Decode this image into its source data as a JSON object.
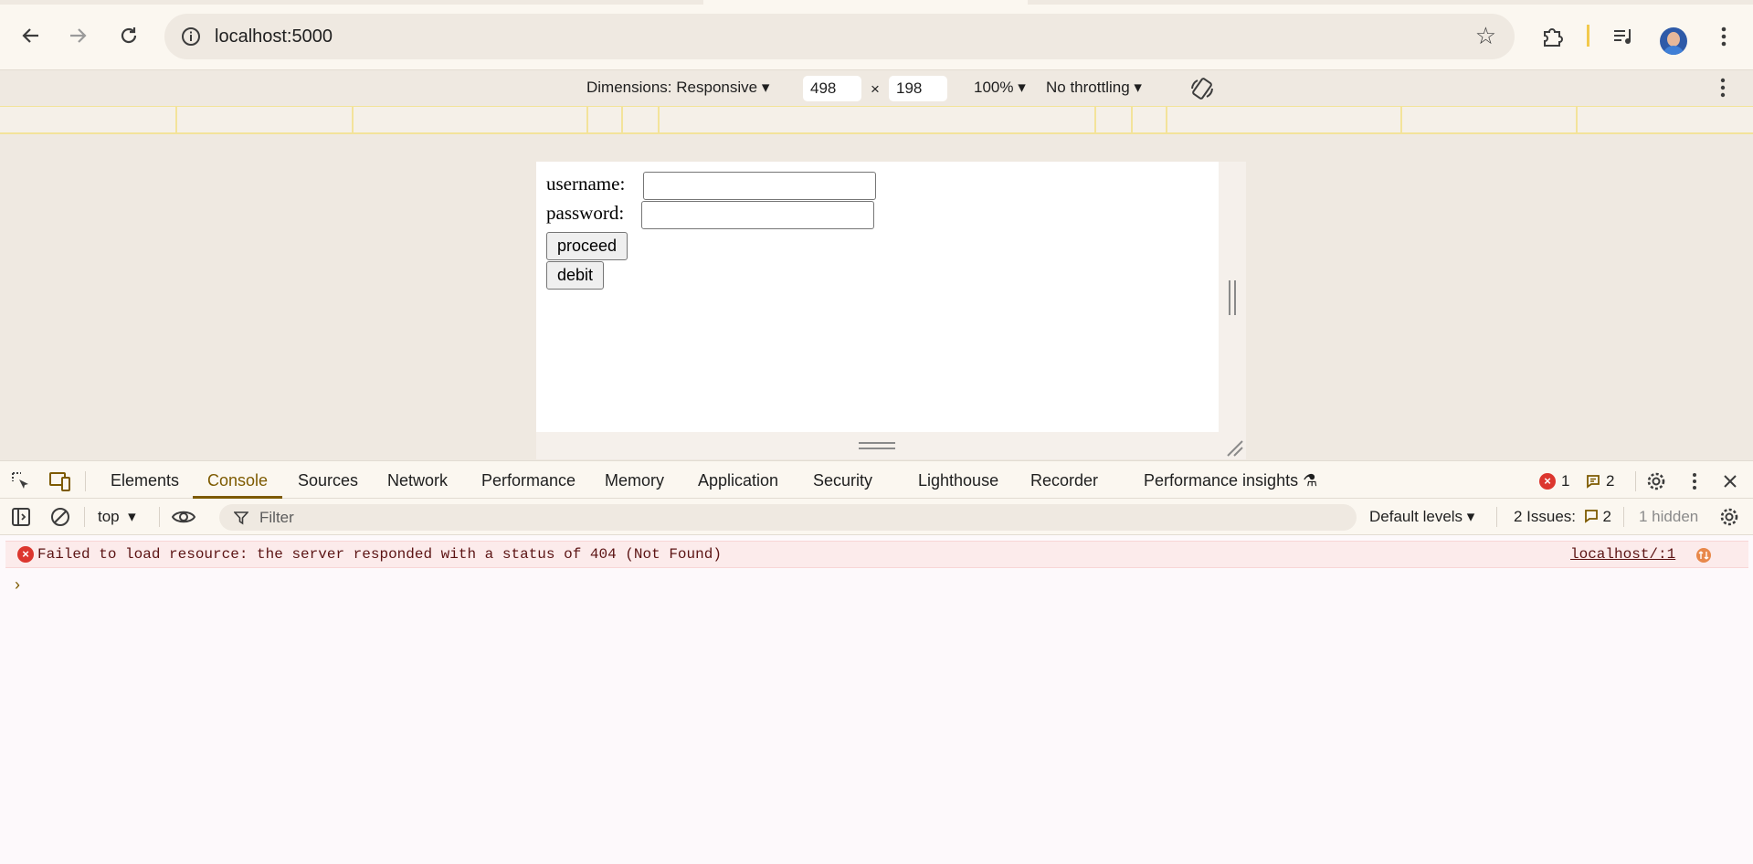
{
  "browser": {
    "url": "localhost:5000"
  },
  "device_toolbar": {
    "dimensions_label": "Dimensions: Responsive",
    "width": "498",
    "separator": "×",
    "height": "198",
    "zoom": "100%",
    "throttling": "No throttling"
  },
  "page": {
    "username_label": "username:",
    "password_label": "password:",
    "proceed_label": "proceed",
    "debit_label": "debit"
  },
  "devtools": {
    "tabs": [
      "Elements",
      "Console",
      "Sources",
      "Network",
      "Performance",
      "Memory",
      "Application",
      "Security",
      "Lighthouse",
      "Recorder",
      "Performance insights"
    ],
    "active_tab": "Console",
    "error_count": "1",
    "message_count": "2"
  },
  "console": {
    "context": "top",
    "filter_placeholder": "Filter",
    "levels": "Default levels",
    "issues_label": "2 Issues:",
    "issues_count": "2",
    "hidden": "1 hidden",
    "error_message": "Failed to load resource: the server responded with a status of 404 (Not Found)",
    "error_source": "localhost/:1",
    "prompt": "›"
  },
  "colors": {
    "accent": "#7d5a00",
    "error": "#dc362e",
    "chrome_bg": "#fbf7f0"
  }
}
